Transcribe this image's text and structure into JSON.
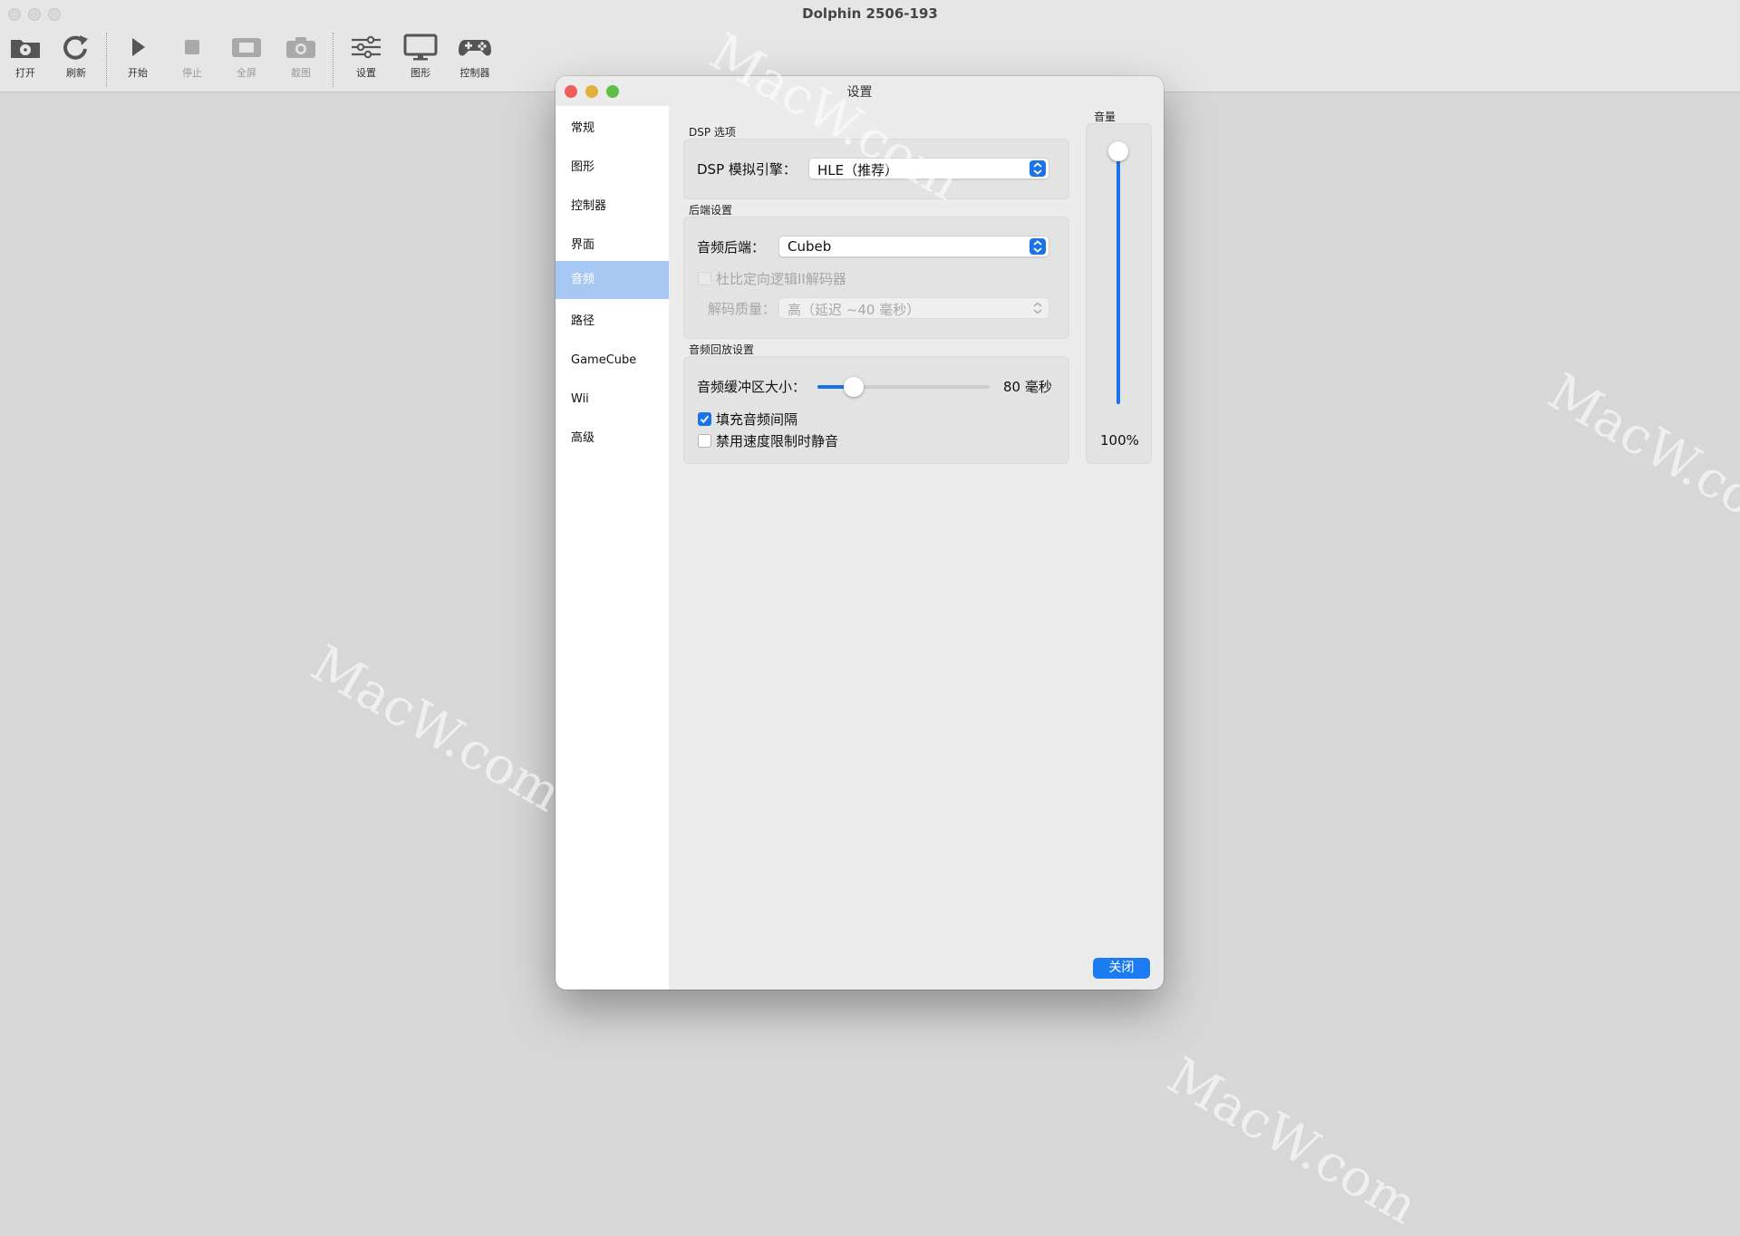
{
  "window": {
    "title": "Dolphin 2506-193"
  },
  "toolbar": {
    "open": "打开",
    "refresh": "刷新",
    "play": "开始",
    "stop": "停止",
    "fullscreen": "全屏",
    "screenshot": "截图",
    "settings": "设置",
    "graphics": "图形",
    "controllers": "控制器"
  },
  "dialog": {
    "title": "设置",
    "close_button": "关闭",
    "sidebar": [
      {
        "label": "常规"
      },
      {
        "label": "图形"
      },
      {
        "label": "控制器"
      },
      {
        "label": "界面"
      },
      {
        "label": "音频",
        "selected": true
      },
      {
        "label": "路径"
      },
      {
        "label": "GameCube"
      },
      {
        "label": "Wii"
      },
      {
        "label": "高级"
      }
    ],
    "dsp": {
      "group_title": "DSP 选项",
      "engine_label": "DSP 模拟引擎：",
      "engine_value": "HLE（推荐）"
    },
    "backend": {
      "group_title": "后端设置",
      "backend_label": "音频后端：",
      "backend_value": "Cubeb",
      "dolby_label": "杜比定向逻辑II解码器",
      "dolby_checked": false,
      "quality_label": "解码质量：",
      "quality_value": "高（延迟 ~40 毫秒）"
    },
    "playback": {
      "group_title": "音频回放设置",
      "buffer_label": "音频缓冲区大小：",
      "buffer_value": "80 毫秒",
      "buffer_slider_fraction": 0.17,
      "fill_gaps_label": "填充音频间隔",
      "fill_gaps_checked": true,
      "mute_label": "禁用速度限制时静音",
      "mute_checked": false
    },
    "volume": {
      "title": "音量",
      "value": "100%",
      "level": 1.0
    }
  },
  "colors": {
    "accent": "#1a73e8",
    "sidebar_selected": "#a8c8f4",
    "traffic_red": "#ec5f57",
    "traffic_yellow": "#e1b13c",
    "traffic_green": "#5dc046"
  },
  "watermark": "MacW.com"
}
